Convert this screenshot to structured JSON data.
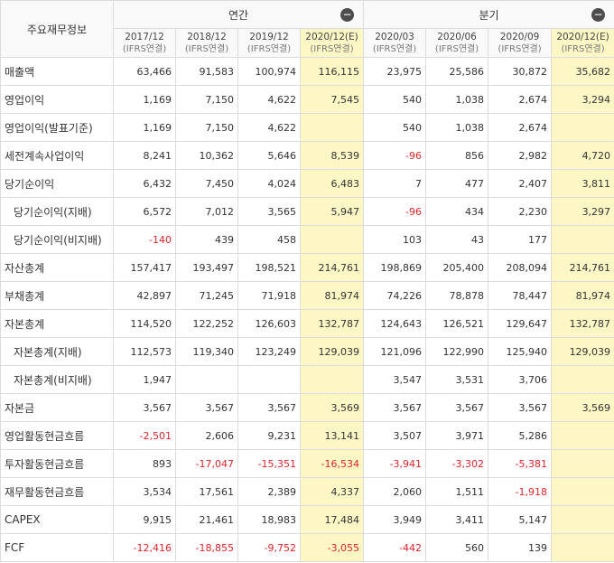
{
  "header": {
    "corner_label": "주요재무정보",
    "annual_label": "연간",
    "quarter_label": "분기",
    "collapse_icon": "minus-circle-icon",
    "periods": [
      {
        "period": "2017/12",
        "basis": "(IFRS연결)",
        "estimate": false
      },
      {
        "period": "2018/12",
        "basis": "(IFRS연결)",
        "estimate": false
      },
      {
        "period": "2019/12",
        "basis": "(IFRS연결)",
        "estimate": false
      },
      {
        "period": "2020/12(E)",
        "basis": "(IFRS연결)",
        "estimate": true
      },
      {
        "period": "2020/03",
        "basis": "(IFRS연결)",
        "estimate": false
      },
      {
        "period": "2020/06",
        "basis": "(IFRS연결)",
        "estimate": false
      },
      {
        "period": "2020/09",
        "basis": "(IFRS연결)",
        "estimate": false
      },
      {
        "period": "2020/12(E)",
        "basis": "(IFRS연결)",
        "estimate": true
      }
    ]
  },
  "colors": {
    "estimate_bg": "#fdf7c6",
    "negative": "#e0242b"
  },
  "rows": [
    {
      "label": "매출액",
      "indent": false,
      "values": [
        "63,466",
        "91,583",
        "100,974",
        "116,115",
        "23,975",
        "25,586",
        "30,872",
        "35,682"
      ]
    },
    {
      "label": "영업이익",
      "indent": false,
      "values": [
        "1,169",
        "7,150",
        "4,622",
        "7,545",
        "540",
        "1,038",
        "2,674",
        "3,294"
      ]
    },
    {
      "label": "영업이익(발표기준)",
      "indent": false,
      "values": [
        "1,169",
        "7,150",
        "4,622",
        "",
        "540",
        "1,038",
        "2,674",
        ""
      ]
    },
    {
      "label": "세전계속사업이익",
      "indent": false,
      "values": [
        "8,241",
        "10,362",
        "5,646",
        "8,539",
        "-96",
        "856",
        "2,982",
        "4,720"
      ]
    },
    {
      "label": "당기순이익",
      "indent": false,
      "values": [
        "6,432",
        "7,450",
        "4,024",
        "6,483",
        "7",
        "477",
        "2,407",
        "3,811"
      ]
    },
    {
      "label": "당기순이익(지배)",
      "indent": true,
      "values": [
        "6,572",
        "7,012",
        "3,565",
        "5,947",
        "-96",
        "434",
        "2,230",
        "3,297"
      ]
    },
    {
      "label": "당기순이익(비지배)",
      "indent": true,
      "values": [
        "-140",
        "439",
        "458",
        "",
        "103",
        "43",
        "177",
        ""
      ]
    },
    {
      "label": "자산총계",
      "indent": false,
      "values": [
        "157,417",
        "193,497",
        "198,521",
        "214,761",
        "198,869",
        "205,400",
        "208,094",
        "214,761"
      ]
    },
    {
      "label": "부채총계",
      "indent": false,
      "values": [
        "42,897",
        "71,245",
        "71,918",
        "81,974",
        "74,226",
        "78,878",
        "78,447",
        "81,974"
      ]
    },
    {
      "label": "자본총계",
      "indent": false,
      "values": [
        "114,520",
        "122,252",
        "126,603",
        "132,787",
        "124,643",
        "126,521",
        "129,647",
        "132,787"
      ]
    },
    {
      "label": "자본총계(지배)",
      "indent": true,
      "values": [
        "112,573",
        "119,340",
        "123,249",
        "129,039",
        "121,096",
        "122,990",
        "125,940",
        "129,039"
      ]
    },
    {
      "label": "자본총계(비지배)",
      "indent": true,
      "values": [
        "1,947",
        "",
        "",
        "",
        "3,547",
        "3,531",
        "3,706",
        ""
      ]
    },
    {
      "label": "자본금",
      "indent": false,
      "values": [
        "3,567",
        "3,567",
        "3,567",
        "3,569",
        "3,567",
        "3,567",
        "3,567",
        "3,569"
      ]
    },
    {
      "label": "영업활동현금흐름",
      "indent": false,
      "values": [
        "-2,501",
        "2,606",
        "9,231",
        "13,141",
        "3,507",
        "3,971",
        "5,286",
        ""
      ]
    },
    {
      "label": "투자활동현금흐름",
      "indent": false,
      "values": [
        "893",
        "-17,047",
        "-15,351",
        "-16,534",
        "-3,941",
        "-3,302",
        "-5,381",
        ""
      ]
    },
    {
      "label": "재무활동현금흐름",
      "indent": false,
      "values": [
        "3,534",
        "17,561",
        "2,389",
        "4,337",
        "2,060",
        "1,511",
        "-1,918",
        ""
      ]
    },
    {
      "label": "CAPEX",
      "indent": false,
      "values": [
        "9,915",
        "21,461",
        "18,983",
        "17,484",
        "3,949",
        "3,411",
        "5,147",
        ""
      ]
    },
    {
      "label": "FCF",
      "indent": false,
      "values": [
        "-12,416",
        "-18,855",
        "-9,752",
        "-3,055",
        "-442",
        "560",
        "139",
        ""
      ]
    }
  ]
}
